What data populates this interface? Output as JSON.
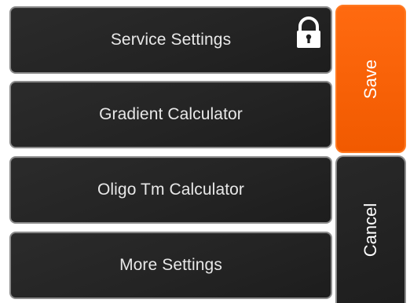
{
  "menu": {
    "items": [
      {
        "label": "Service Settings",
        "icon": "lock-icon",
        "locked": true
      },
      {
        "label": "Gradient Calculator"
      },
      {
        "label": "Oligo Tm Calculator"
      },
      {
        "label": "More Settings"
      }
    ]
  },
  "actions": {
    "save_label": "Save",
    "cancel_label": "Cancel"
  },
  "colors": {
    "background": "#ffffff",
    "button_dark": "#242424",
    "button_border": "#8c8c8c",
    "button_text": "#e8e8e8",
    "save_accent": "#f15a00"
  }
}
